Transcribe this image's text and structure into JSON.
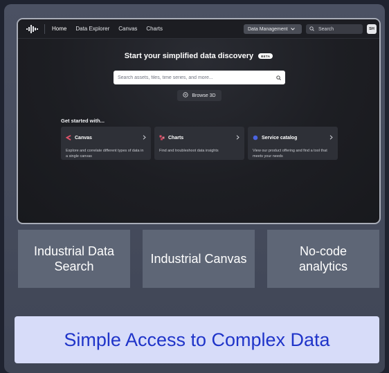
{
  "nav": {
    "items": [
      {
        "label": "Home"
      },
      {
        "label": "Data Explorer"
      },
      {
        "label": "Canvas"
      },
      {
        "label": "Charts"
      }
    ],
    "data_management_label": "Data Management",
    "search_label": "Search",
    "avatar_initials": "SH"
  },
  "hero": {
    "title": "Start your simplified data discovery",
    "badge": "BETA",
    "search_placeholder": "Search assets, files, time series, and more...",
    "browse_label": "Browse 3D"
  },
  "get_started": {
    "heading": "Get started with...",
    "cards": [
      {
        "title": "Canvas",
        "description": "Explore and correlate different types of data in a single canvas",
        "icon": "canvas-icon",
        "color": "#e0526a"
      },
      {
        "title": "Charts",
        "description": "Find and troubleshoot data insights",
        "icon": "charts-icon",
        "color": "#e0526a"
      },
      {
        "title": "Service catalog",
        "description": "View our product offering and find a tool that meets your needs",
        "icon": "service-catalog-icon",
        "color": "#4a63e0"
      }
    ]
  },
  "features": [
    {
      "label": "Industrial Data Search"
    },
    {
      "label": "Industrial Canvas"
    },
    {
      "label": "No-code analytics"
    }
  ],
  "banner": {
    "text": "Simple Access to Complex Data"
  },
  "colors": {
    "banner_bg": "#d7dcf9",
    "banner_text": "#1f34c9",
    "feature_bg": "#5e6676"
  }
}
